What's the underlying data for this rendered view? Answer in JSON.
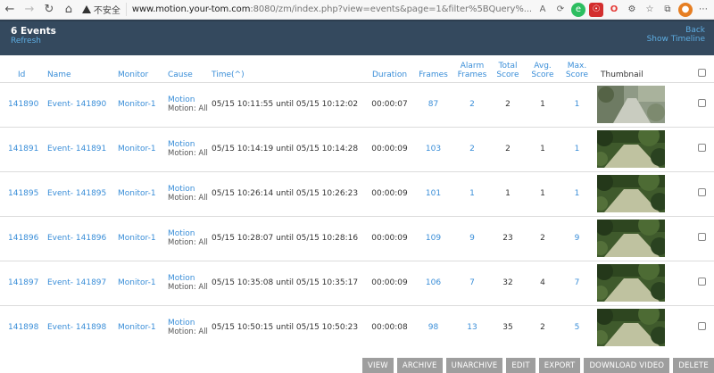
{
  "browser": {
    "security_label": "不安全",
    "url_host": "www.motion.your-tom.com",
    "url_rest": ":8080/zm/index.php?view=events&page=1&filter%5BQuery%..."
  },
  "header": {
    "title": "6 Events",
    "refresh": "Refresh",
    "back": "Back",
    "timeline": "Show Timeline"
  },
  "columns": {
    "id": "Id",
    "name": "Name",
    "monitor": "Monitor",
    "cause": "Cause",
    "time": "Time(^)",
    "duration": "Duration",
    "frames": "Frames",
    "alarm1": "Alarm",
    "alarm2": "Frames",
    "total1": "Total",
    "total2": "Score",
    "avg1": "Avg.",
    "avg2": "Score",
    "max1": "Max.",
    "max2": "Score",
    "thumbnail": "Thumbnail"
  },
  "rows": [
    {
      "id": "141890",
      "name": "Event- 141890",
      "monitor": "Monitor-1",
      "cause": "Motion",
      "cause_sub": "Motion: All",
      "time": "05/15 10:11:55 until 05/15 10:12:02",
      "duration": "00:00:07",
      "frames": "87",
      "alarm": "2",
      "total": "2",
      "avg": "1",
      "max": "1",
      "thumb": "light"
    },
    {
      "id": "141891",
      "name": "Event- 141891",
      "monitor": "Monitor-1",
      "cause": "Motion",
      "cause_sub": "Motion: All",
      "time": "05/15 10:14:19 until 05/15 10:14:28",
      "duration": "00:00:09",
      "frames": "103",
      "alarm": "2",
      "total": "2",
      "avg": "1",
      "max": "1",
      "thumb": "green"
    },
    {
      "id": "141895",
      "name": "Event- 141895",
      "monitor": "Monitor-1",
      "cause": "Motion",
      "cause_sub": "Motion: All",
      "time": "05/15 10:26:14 until 05/15 10:26:23",
      "duration": "00:00:09",
      "frames": "101",
      "alarm": "1",
      "total": "1",
      "avg": "1",
      "max": "1",
      "thumb": "green"
    },
    {
      "id": "141896",
      "name": "Event- 141896",
      "monitor": "Monitor-1",
      "cause": "Motion",
      "cause_sub": "Motion: All",
      "time": "05/15 10:28:07 until 05/15 10:28:16",
      "duration": "00:00:09",
      "frames": "109",
      "alarm": "9",
      "total": "23",
      "avg": "2",
      "max": "9",
      "thumb": "green"
    },
    {
      "id": "141897",
      "name": "Event- 141897",
      "monitor": "Monitor-1",
      "cause": "Motion",
      "cause_sub": "Motion: All",
      "time": "05/15 10:35:08 until 05/15 10:35:17",
      "duration": "00:00:09",
      "frames": "106",
      "alarm": "7",
      "total": "32",
      "avg": "4",
      "max": "7",
      "thumb": "green"
    },
    {
      "id": "141898",
      "name": "Event- 141898",
      "monitor": "Monitor-1",
      "cause": "Motion",
      "cause_sub": "Motion: All",
      "time": "05/15 10:50:15 until 05/15 10:50:23",
      "duration": "00:00:08",
      "frames": "98",
      "alarm": "13",
      "total": "35",
      "avg": "2",
      "max": "5",
      "thumb": "green"
    }
  ],
  "buttons": [
    "VIEW",
    "ARCHIVE",
    "UNARCHIVE",
    "EDIT",
    "EXPORT",
    "DOWNLOAD VIDEO",
    "DELETE"
  ],
  "colors": {
    "header_bg": "#34495e",
    "link": "#3a8ed8",
    "button_bg": "#9e9e9e"
  }
}
